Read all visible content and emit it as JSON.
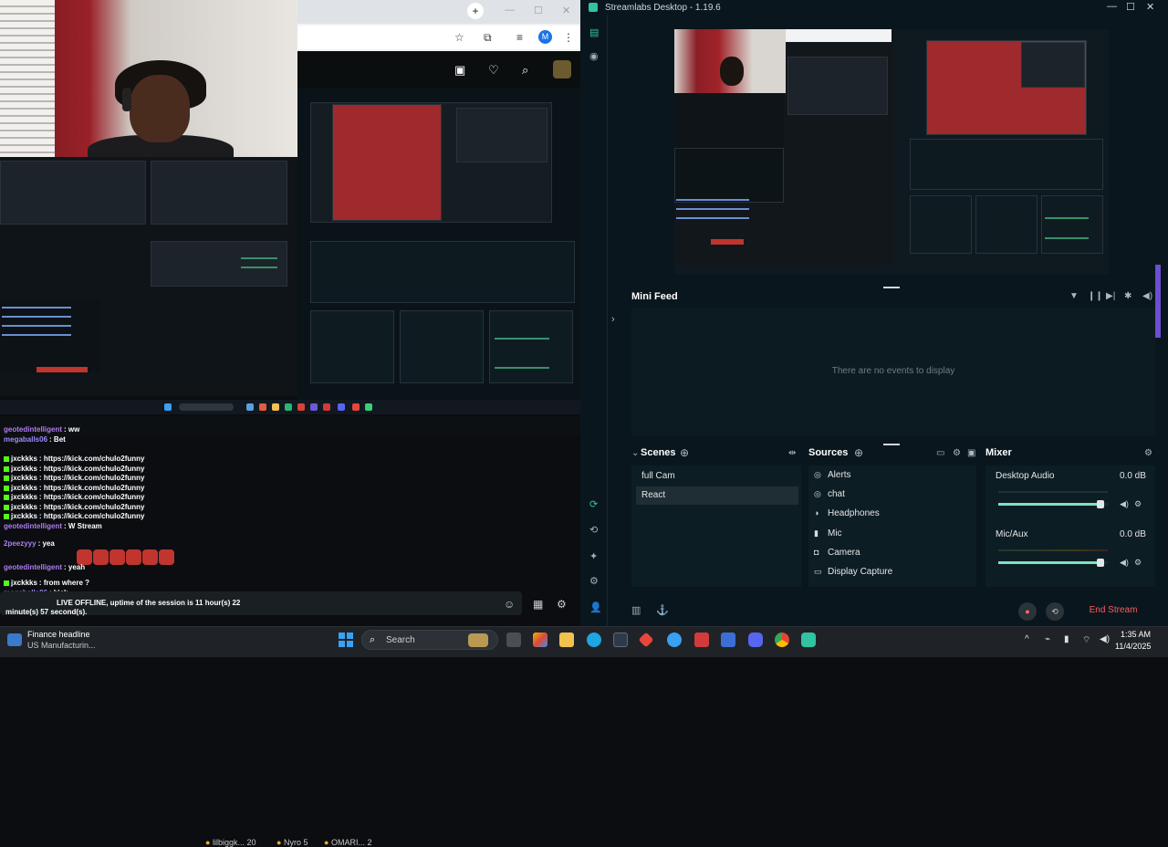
{
  "browser": {
    "new_tab_icon": "+",
    "minimize": "—",
    "maximize": "☐",
    "close": "✕",
    "profile_initial": "M"
  },
  "pinned": [
    {
      "name": "lilbiggk...",
      "count": "20"
    },
    {
      "name": "Nyro",
      "count": "5"
    },
    {
      "name": "OMARI...",
      "count": "2"
    }
  ],
  "chat": {
    "messages": [
      {
        "user": "geotedintelligent",
        "text": "ww",
        "color": "#b07cf0"
      },
      {
        "user": "megaballs06",
        "text": "Bet",
        "color": "#9b8cff"
      },
      {
        "user": "jxckkks",
        "text": "https://kick.com/chulo2funny",
        "color": "#ffffff"
      },
      {
        "user": "jxckkks",
        "text": "https://kick.com/chulo2funny",
        "color": "#ffffff"
      },
      {
        "user": "jxckkks",
        "text": "https://kick.com/chulo2funny",
        "color": "#ffffff"
      },
      {
        "user": "jxckkks",
        "text": "https://kick.com/chulo2funny",
        "color": "#ffffff"
      },
      {
        "user": "jxckkks",
        "text": "https://kick.com/chulo2funny",
        "color": "#ffffff"
      },
      {
        "user": "jxckkks",
        "text": "https://kick.com/chulo2funny",
        "color": "#ffffff"
      },
      {
        "user": "jxckkks",
        "text": "https://kick.com/chulo2funny",
        "color": "#ffffff"
      },
      {
        "user": "geotedintelligent",
        "text": "W Stream",
        "color": "#b07cf0"
      },
      {
        "user": "2peezyyy",
        "text": "yea",
        "color": "#b07cf0"
      },
      {
        "user": "geotedintelligent",
        "text": "yeah",
        "color": "#b07cf0"
      },
      {
        "user": "jxckkks",
        "text": "from where ?",
        "color": "#ffffff"
      },
      {
        "user": "megaballs06",
        "text": "kick",
        "color": "#9b8cff"
      }
    ],
    "bot_line_1": "LIVE OFFLINE, uptime of the session is 11 hour(s) 22",
    "bot_line_2": "minute(s) 57 second(s)."
  },
  "streamlabs": {
    "title": "Streamlabs Desktop - 1.19.6",
    "mini_feed": {
      "title": "Mini Feed",
      "empty": "There are no events to display"
    },
    "scenes": {
      "title": "Scenes",
      "items": [
        "full Cam",
        "React"
      ],
      "selected": "React"
    },
    "sources": {
      "title": "Sources",
      "items": [
        {
          "label": "Alerts",
          "icon": "alerts-icon"
        },
        {
          "label": "chat",
          "icon": "browser-source-icon"
        },
        {
          "label": "Headphones",
          "icon": "audio-output-icon"
        },
        {
          "label": "Mic",
          "icon": "mic-icon"
        },
        {
          "label": "Camera",
          "icon": "camera-icon"
        },
        {
          "label": "Display Capture",
          "icon": "display-capture-icon"
        }
      ]
    },
    "mixer": {
      "title": "Mixer",
      "channels": [
        {
          "label": "Desktop Audio",
          "db": "0.0 dB",
          "level": 0.95
        },
        {
          "label": "Mic/Aux",
          "db": "0.0 dB",
          "level": 0.95
        }
      ]
    },
    "end_stream": "End Stream",
    "accent": "#31c3a2"
  },
  "taskbar": {
    "widget_line_1": "Finance headline",
    "widget_line_2": "US Manufacturin...",
    "search_placeholder": "Search",
    "time": "1:35 AM",
    "date": "11/4/2025"
  }
}
